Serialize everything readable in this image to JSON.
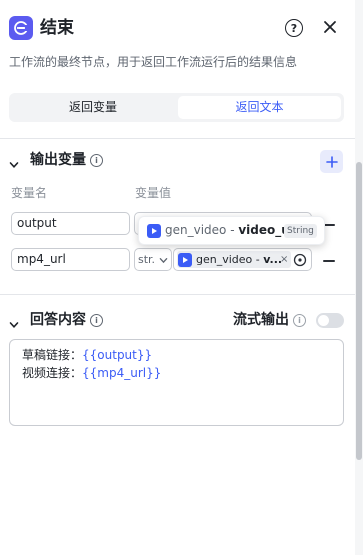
{
  "header": {
    "title": "结束",
    "description": "工作流的最终节点，用于返回工作流运行后的结果信息"
  },
  "tabs": [
    {
      "label": "返回变量",
      "active": false
    },
    {
      "label": "返回文本",
      "active": true
    }
  ],
  "output_section": {
    "title": "输出变量",
    "col_name": "变量名",
    "col_value": "变量值",
    "rows": [
      {
        "name": "output"
      },
      {
        "name": "mp4_url",
        "type_short": "str.",
        "ref_node": "gen_video",
        "ref_sep": " - ",
        "ref_field": "v..."
      }
    ]
  },
  "tooltip": {
    "node": "gen_video",
    "sep": " - ",
    "field": "video_url",
    "type": "String"
  },
  "answer_section": {
    "title": "回答内容",
    "stream_label": "流式输出",
    "stream_enabled": false,
    "lines": [
      {
        "label": "草稿链接：",
        "var": "{{output}}"
      },
      {
        "label": "视频连接：",
        "var": "{{mp4_url}}"
      }
    ]
  },
  "colors": {
    "accent": "#3b5cf6",
    "node_icon": "#5b5bf0"
  }
}
